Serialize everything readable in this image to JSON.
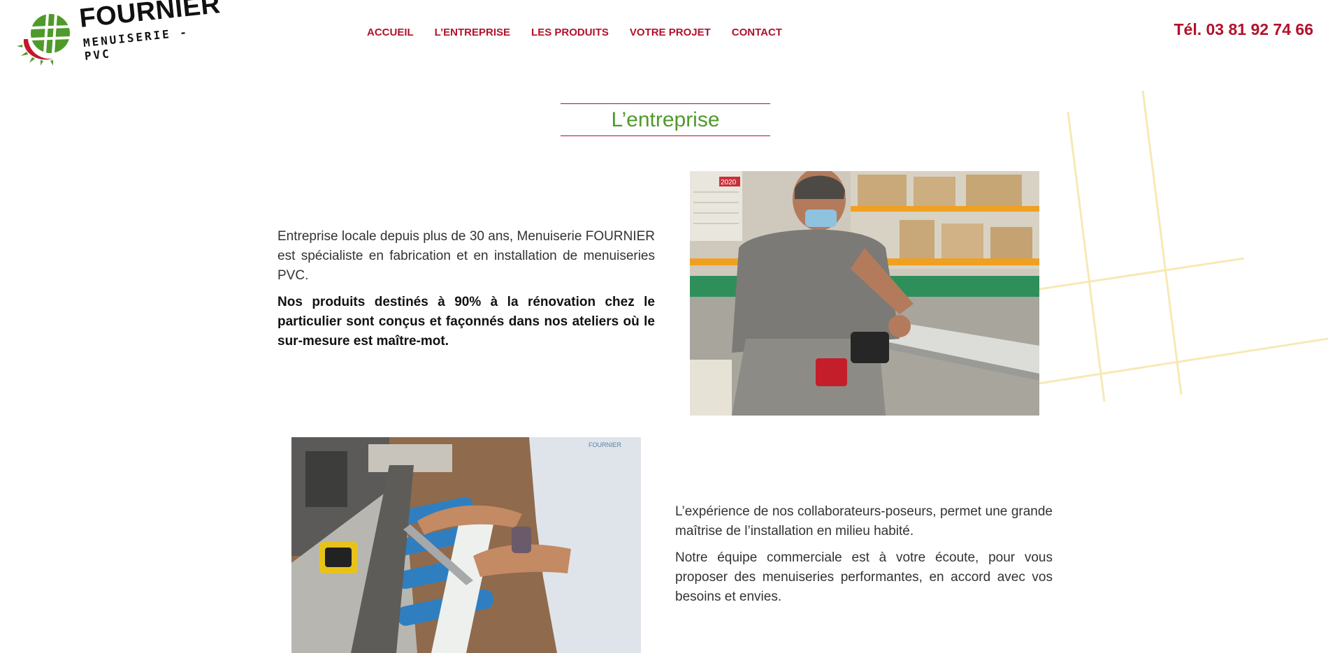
{
  "header": {
    "logo": {
      "name": "FOURNIER",
      "subtitle": "MENUISERIE - PVC"
    },
    "nav": [
      {
        "label": "ACCUEIL"
      },
      {
        "label": "L’ENTREPRISE"
      },
      {
        "label": "LES PRODUITS"
      },
      {
        "label": "VOTRE PROJET"
      },
      {
        "label": "CONTACT"
      }
    ],
    "phone": "Tél. 03 81 92 74 66"
  },
  "main": {
    "title": "L’entreprise",
    "block1": {
      "p1": "Entreprise locale depuis plus de 30 ans, Menuiserie FOURNIER est spécialiste en fabrication et en installation de menuiseries PVC.",
      "p2": "Nos produits destinés à 90% à la rénovation chez le particulier sont conçus et façonnés dans nos ateliers où le sur-mesure est maître-mot."
    },
    "block2": {
      "p1": "L’expérience de nos collaborateurs-poseurs, permet une grande maîtrise de l’installation en milieu habité.",
      "p2": "Notre équipe commerciale est à votre écoute, pour vous proposer des menuiseries performantes, en accord avec vos besoins et envies."
    },
    "photo1_calendar_year": "2020",
    "photo2_shirt_logo": "FOURNIER"
  },
  "colors": {
    "brand_red": "#b2122a",
    "brand_green": "#4f9a2a",
    "deco_yellow": "#f7e9b4"
  }
}
